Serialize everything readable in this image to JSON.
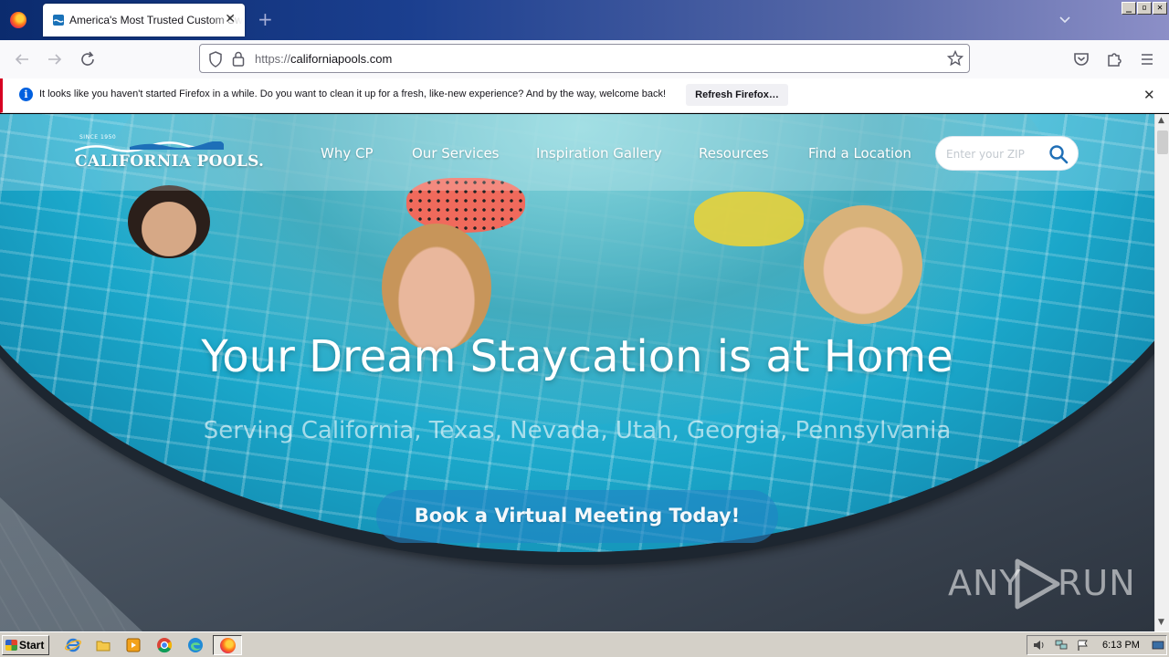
{
  "browser": {
    "tab_title": "America's Most Trusted Custom Sw",
    "tab_close": "✕",
    "new_tab": "+",
    "url_scheme": "https://",
    "url_host": "californiapools.com"
  },
  "notification": {
    "message": "It looks like you haven't started Firefox in a while. Do you want to clean it up for a fresh, like-new experience? And by the way, welcome back!",
    "button": "Refresh Firefox…",
    "close": "✕"
  },
  "site": {
    "brand_since": "SINCE 1950",
    "brand_name": "CALIFORNIA POOLS.",
    "menu": [
      "Why CP",
      "Our Services",
      "Inspiration Gallery",
      "Resources",
      "Find a Location"
    ],
    "zip_placeholder": "Enter your ZIP",
    "headline": "Your Dream Staycation is at Home",
    "subline": "Serving California, Texas, Nevada, Utah, Georgia, Pennsylvania",
    "cta": "Book a Virtual Meeting Today!"
  },
  "watermark": {
    "left": "ANY",
    "right": "RUN"
  },
  "taskbar": {
    "start": "Start",
    "clock": "6:13 PM"
  },
  "colors": {
    "firefox_notification_accent": "#d70022",
    "info_blue": "#0060df",
    "cta_blue": "#2284c4"
  }
}
